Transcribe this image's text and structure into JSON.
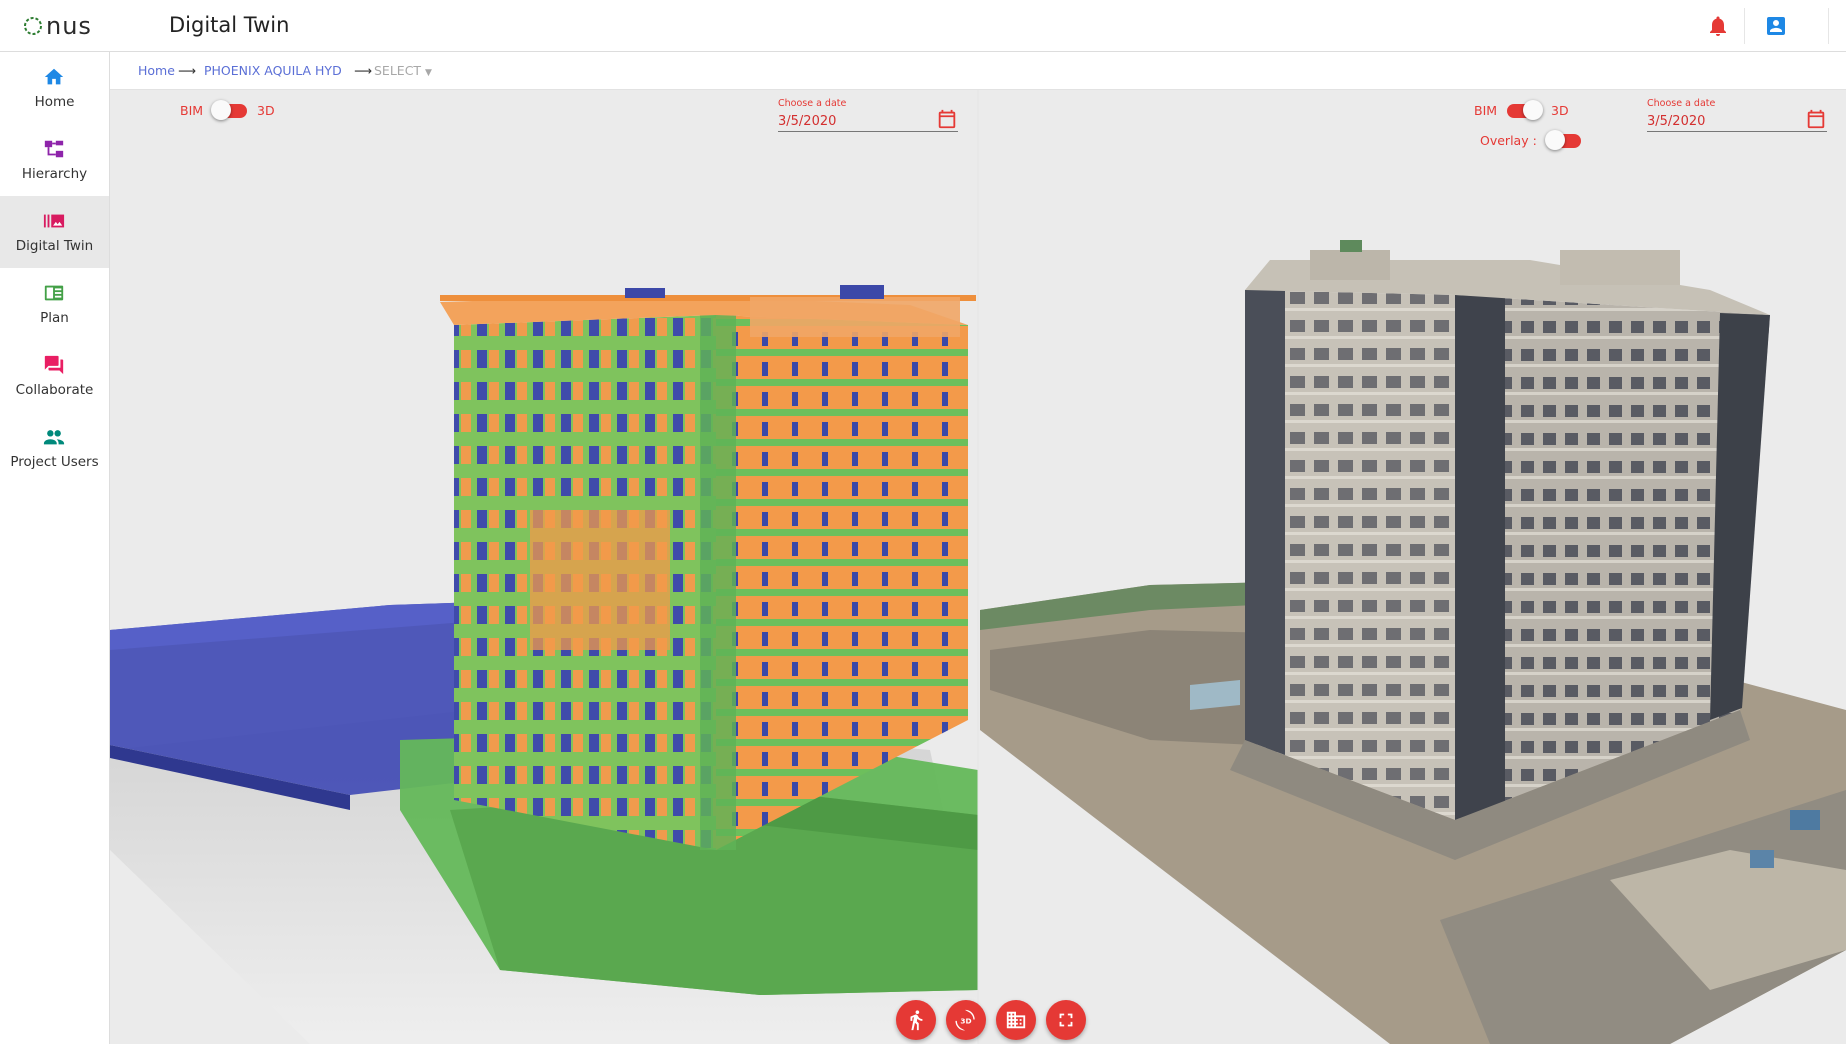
{
  "header": {
    "logo_text": "nus",
    "title": "Digital Twin"
  },
  "sidebar": {
    "items": [
      {
        "label": "Home",
        "icon": "home-icon",
        "color": "#1e88e5"
      },
      {
        "label": "Hierarchy",
        "icon": "hierarchy-icon",
        "color": "#8e24aa"
      },
      {
        "label": "Digital Twin",
        "icon": "digital-twin-icon",
        "color": "#d81b60",
        "active": true
      },
      {
        "label": "Plan",
        "icon": "plan-icon",
        "color": "#43a047"
      },
      {
        "label": "Collaborate",
        "icon": "chat-icon",
        "color": "#e91e63"
      },
      {
        "label": "Project Users",
        "icon": "users-icon",
        "color": "#00897b"
      }
    ]
  },
  "breadcrumb": {
    "home": "Home",
    "project": "PHOENIX AQUILA HYD",
    "select": "SELECT"
  },
  "left_panel": {
    "bim_label": "BIM",
    "three_d_label": "3D",
    "toggle_state": "BIM",
    "date_label": "Choose a date",
    "date_value": "3/5/2020"
  },
  "right_panel": {
    "bim_label": "BIM",
    "three_d_label": "3D",
    "toggle_state": "3D",
    "overlay_label": "Overlay :",
    "overlay_on": false,
    "date_label": "Choose a date",
    "date_value": "3/5/2020"
  },
  "toolbar": {
    "buttons": [
      "walk-icon",
      "rotate-3d-icon",
      "building-icon",
      "fullscreen-icon"
    ]
  },
  "colors": {
    "accent_red": "#e53935",
    "link_blue": "#5b6fd6"
  }
}
